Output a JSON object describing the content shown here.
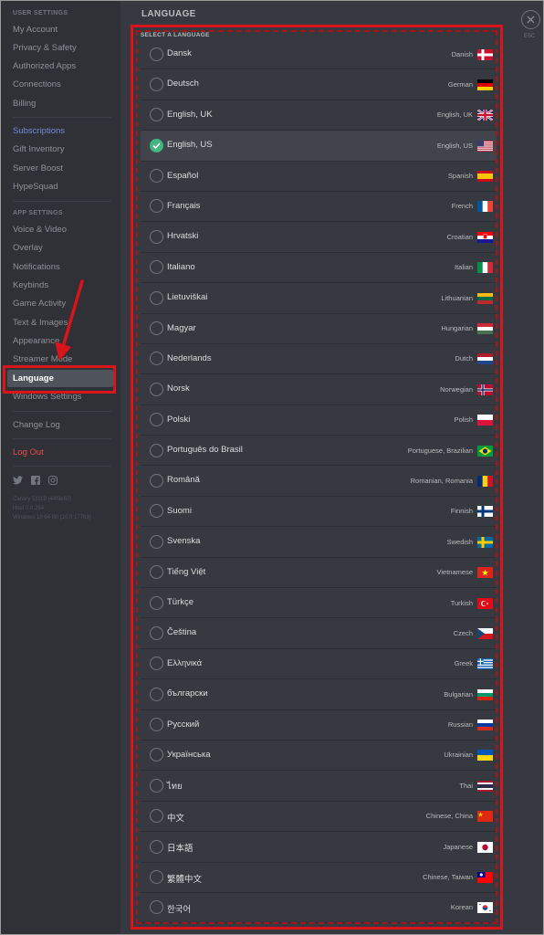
{
  "sidebar": {
    "sections": [
      {
        "header": "User Settings",
        "items": [
          {
            "id": "my-account",
            "label": "My Account"
          },
          {
            "id": "privacy-safety",
            "label": "Privacy & Safety"
          },
          {
            "id": "authorized-apps",
            "label": "Authorized Apps"
          },
          {
            "id": "connections",
            "label": "Connections"
          },
          {
            "id": "billing",
            "label": "Billing"
          }
        ]
      },
      {
        "header": "",
        "items": [
          {
            "id": "subscriptions",
            "label": "Subscriptions"
          },
          {
            "id": "gift-inventory",
            "label": "Gift Inventory"
          },
          {
            "id": "server-boost",
            "label": "Server Boost"
          },
          {
            "id": "hypesquad",
            "label": "HypeSquad"
          }
        ]
      },
      {
        "header": "App Settings",
        "items": [
          {
            "id": "voice-video",
            "label": "Voice & Video"
          },
          {
            "id": "overlay",
            "label": "Overlay"
          },
          {
            "id": "notifications",
            "label": "Notifications"
          },
          {
            "id": "keybinds",
            "label": "Keybinds"
          },
          {
            "id": "game-activity",
            "label": "Game Activity"
          },
          {
            "id": "text-images",
            "label": "Text & Images"
          },
          {
            "id": "appearance",
            "label": "Appearance"
          },
          {
            "id": "streamer-mode",
            "label": "Streamer Mode"
          },
          {
            "id": "language",
            "label": "Language"
          },
          {
            "id": "windows-settings",
            "label": "Windows Settings"
          }
        ]
      },
      {
        "header": "",
        "items": [
          {
            "id": "change-log",
            "label": "Change Log"
          }
        ]
      },
      {
        "header": "",
        "items": [
          {
            "id": "log-out",
            "label": "Log Out"
          }
        ]
      }
    ],
    "active_item": "language",
    "social_icons": [
      "twitter-icon",
      "facebook-icon",
      "instagram-icon"
    ],
    "version_info": [
      "Canary 51119 (44f9e60)",
      "Host 0.0.264",
      "Windows 10 64-Bit (10.0.17763)"
    ]
  },
  "content": {
    "title": "LANGUAGE",
    "select_header": "SELECT A LANGUAGE",
    "close_label": "ESC",
    "selected_language": "English, US",
    "languages": [
      {
        "native": "Dansk",
        "english": "Danish",
        "flag": "dk"
      },
      {
        "native": "Deutsch",
        "english": "German",
        "flag": "de"
      },
      {
        "native": "English, UK",
        "english": "English, UK",
        "flag": "gb"
      },
      {
        "native": "English, US",
        "english": "English, US",
        "flag": "us"
      },
      {
        "native": "Español",
        "english": "Spanish",
        "flag": "es"
      },
      {
        "native": "Français",
        "english": "French",
        "flag": "fr"
      },
      {
        "native": "Hrvatski",
        "english": "Croatian",
        "flag": "hr"
      },
      {
        "native": "Italiano",
        "english": "Italian",
        "flag": "it"
      },
      {
        "native": "Lietuviškai",
        "english": "Lithuanian",
        "flag": "lt"
      },
      {
        "native": "Magyar",
        "english": "Hungarian",
        "flag": "hu"
      },
      {
        "native": "Nederlands",
        "english": "Dutch",
        "flag": "nl"
      },
      {
        "native": "Norsk",
        "english": "Norwegian",
        "flag": "no"
      },
      {
        "native": "Polski",
        "english": "Polish",
        "flag": "pl"
      },
      {
        "native": "Português do Brasil",
        "english": "Portuguese, Brazilian",
        "flag": "br"
      },
      {
        "native": "Română",
        "english": "Romanian, Romania",
        "flag": "ro"
      },
      {
        "native": "Suomi",
        "english": "Finnish",
        "flag": "fi"
      },
      {
        "native": "Svenska",
        "english": "Swedish",
        "flag": "se"
      },
      {
        "native": "Tiếng Việt",
        "english": "Vietnamese",
        "flag": "vn"
      },
      {
        "native": "Türkçe",
        "english": "Turkish",
        "flag": "tr"
      },
      {
        "native": "Čeština",
        "english": "Czech",
        "flag": "cz"
      },
      {
        "native": "Ελληνικά",
        "english": "Greek",
        "flag": "gr"
      },
      {
        "native": "български",
        "english": "Bulgarian",
        "flag": "bg"
      },
      {
        "native": "Русский",
        "english": "Russian",
        "flag": "ru"
      },
      {
        "native": "Українська",
        "english": "Ukrainian",
        "flag": "ua"
      },
      {
        "native": "ไทย",
        "english": "Thai",
        "flag": "th"
      },
      {
        "native": "中文",
        "english": "Chinese, China",
        "flag": "cn"
      },
      {
        "native": "日本語",
        "english": "Japanese",
        "flag": "jp"
      },
      {
        "native": "繁體中文",
        "english": "Chinese, Taiwan",
        "flag": "tw"
      },
      {
        "native": "한국어",
        "english": "Korean",
        "flag": "kr"
      }
    ]
  },
  "colors": {
    "background": "#36393f",
    "sidebar": "#2f3136",
    "accent_highlight": "#d9141a",
    "check_green": "#43b581",
    "link_blurple": "#7289da",
    "danger": "#f04747"
  }
}
